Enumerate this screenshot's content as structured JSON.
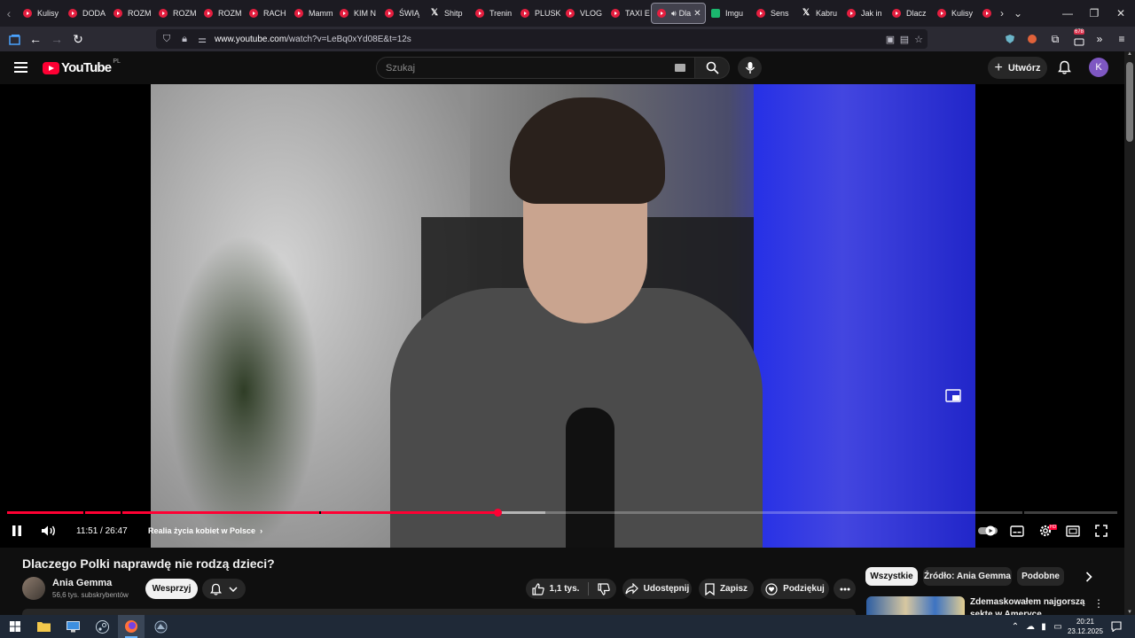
{
  "browser": {
    "tabs": [
      {
        "label": "Kulisy",
        "favicon": "youtube-icon"
      },
      {
        "label": "DODA",
        "favicon": "youtube-icon"
      },
      {
        "label": "ROZM",
        "favicon": "youtube-icon"
      },
      {
        "label": "ROZM",
        "favicon": "youtube-icon"
      },
      {
        "label": "ROZM",
        "favicon": "youtube-icon"
      },
      {
        "label": "RACH",
        "favicon": "youtube-icon"
      },
      {
        "label": "Mamm",
        "favicon": "youtube-icon"
      },
      {
        "label": "KIM N",
        "favicon": "youtube-icon"
      },
      {
        "label": "ŚWIĄ",
        "favicon": "youtube-icon"
      },
      {
        "label": "Shitp",
        "favicon": "x-icon"
      },
      {
        "label": "Trenin",
        "favicon": "youtube-icon"
      },
      {
        "label": "PLUSK",
        "favicon": "youtube-icon"
      },
      {
        "label": "VLOG",
        "favicon": "youtube-icon"
      },
      {
        "label": "TAXI E",
        "favicon": "youtube-icon"
      },
      {
        "label": "Dla",
        "favicon": "youtube-icon",
        "active": true
      },
      {
        "label": "Imgu",
        "favicon": "imgur-icon"
      },
      {
        "label": "Sens",
        "favicon": "youtube-icon"
      },
      {
        "label": "Kabru",
        "favicon": "x-icon"
      },
      {
        "label": "Jak in",
        "favicon": "youtube-icon"
      },
      {
        "label": "Dlacz",
        "favicon": "youtube-icon"
      },
      {
        "label": "Kulisy",
        "favicon": "youtube-icon"
      },
      {
        "label": "",
        "favicon": "youtube-icon"
      }
    ],
    "url_host": "www.youtube.com",
    "url_path": "/watch?v=LeBq0xYd08E&t=12s",
    "extension_badge": "678"
  },
  "youtube": {
    "logo_text": "YouTube",
    "country_code": "PL",
    "search_placeholder": "Szukaj",
    "create_label": "Utwórz",
    "avatar_letter": "K"
  },
  "player": {
    "time_current": "11:51",
    "time_total": "26:47",
    "time_readout": "11:51 / 26:47",
    "chapter_title": "Realia życia kobiet w Polsce",
    "played_fraction": 0.442,
    "buffered_fraction": 0.485
  },
  "video": {
    "title": "Dlaczego Polki naprawdę nie rodzą dzieci?",
    "channel_name": "Ania Gemma",
    "subscribers": "56,6 tys. subskrybentów",
    "support_label": "Wesprzyj",
    "like_count": "1,1 tys.",
    "share_label": "Udostępnij",
    "save_label": "Zapisz",
    "thanks_label": "Podziękuj"
  },
  "recommendations": {
    "chips": [
      "Wszystkie",
      "Źródło: Ania Gemma",
      "Podobne"
    ],
    "first_title": "Zdemaskowałem najgorszą sektę w Ameryce"
  },
  "taskbar": {
    "time": "20:21",
    "date": "23.12.2025"
  },
  "colors": {
    "youtube_red": "#ff0033",
    "page_bg": "#0f0f0f",
    "chip_bg": "#272727"
  }
}
